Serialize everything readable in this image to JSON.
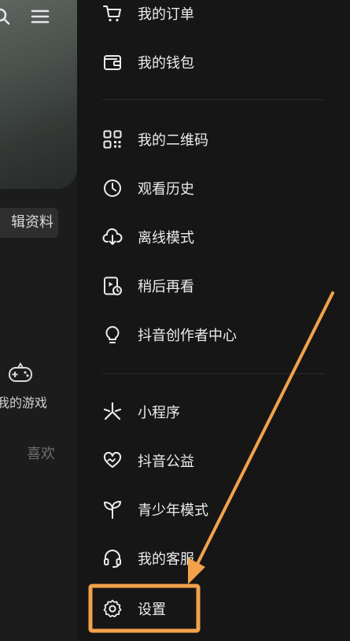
{
  "left_panel": {
    "edit_profile": "辑资料",
    "games_label": "我的游戏",
    "likes_tab": "喜欢"
  },
  "menu": {
    "items": [
      {
        "label": "我的订单",
        "icon": "cart-icon"
      },
      {
        "label": "我的钱包",
        "icon": "wallet-icon"
      },
      {
        "label": "我的二维码",
        "icon": "qr-code-icon"
      },
      {
        "label": "观看历史",
        "icon": "clock-icon"
      },
      {
        "label": "离线模式",
        "icon": "cloud-download-icon"
      },
      {
        "label": "稍后再看",
        "icon": "watch-later-icon"
      },
      {
        "label": "抖音创作者中心",
        "icon": "lightbulb-icon"
      },
      {
        "label": "小程序",
        "icon": "mini-program-icon"
      },
      {
        "label": "抖音公益",
        "icon": "heart-hands-icon"
      },
      {
        "label": "青少年模式",
        "icon": "sprout-icon"
      },
      {
        "label": "我的客服",
        "icon": "headset-icon"
      },
      {
        "label": "设置",
        "icon": "gear-icon"
      }
    ]
  },
  "colors": {
    "background": "#161616",
    "text": "#ececec",
    "highlight": "#f2a24a"
  }
}
